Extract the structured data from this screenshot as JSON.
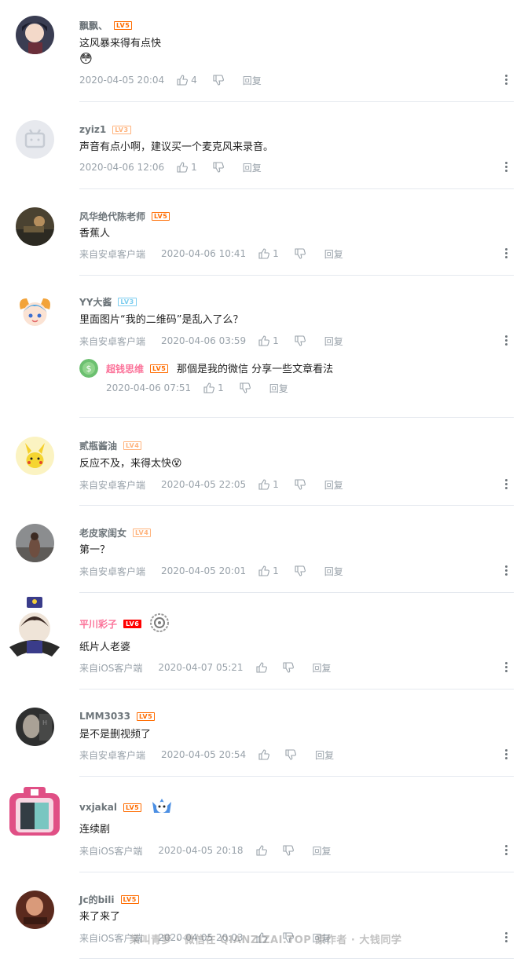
{
  "comments": [
    {
      "user": "飘飘、",
      "level": "LV5",
      "text": "这风暴来得有点快",
      "emoji": "😳",
      "time": "2020-04-05 20:04",
      "likes": "4",
      "reply": "回复"
    },
    {
      "user": "zyiz1",
      "level": "LV3",
      "text": "声音有点小啊，建议买一个麦克风来录音。",
      "time": "2020-04-06 12:06",
      "likes": "1",
      "reply": "回复"
    },
    {
      "user": "风华绝代陈老师",
      "level": "LV5",
      "text": "香蕉人",
      "source": "来自安卓客户端",
      "time": "2020-04-06 10:41",
      "likes": "1",
      "reply": "回复"
    },
    {
      "user": "YY大酱",
      "level": "LV3",
      "text": "里面图片“我的二维码”是乱入了么？",
      "source": "来自安卓客户端",
      "time": "2020-04-06 03:59",
      "likes": "1",
      "reply": "回复",
      "sub_reply": {
        "user": "超钱思维",
        "level": "LV5",
        "text": "那個是我的微信 分享一些文章看法",
        "time": "2020-04-06 07:51",
        "likes": "1",
        "reply": "回复"
      }
    },
    {
      "user": "贰瓶酱油",
      "level": "LV4",
      "text": "反应不及，来得太快",
      "emoji": "😵",
      "source": "来自安卓客户端",
      "time": "2020-04-05 22:05",
      "likes": "1",
      "reply": "回复"
    },
    {
      "user": "老皮家闺女",
      "level": "LV4",
      "text": "第一？",
      "source": "来自安卓客户端",
      "time": "2020-04-05 20:01",
      "likes": "1",
      "reply": "回复"
    },
    {
      "user": "平川彩子",
      "level": "LV6",
      "text": "纸片人老婆",
      "source": "来自iOS客户端",
      "time": "2020-04-07 05:21",
      "likes": "",
      "reply": "回复"
    },
    {
      "user": "LMM3033",
      "level": "LV5",
      "text": "是不是删视频了",
      "source": "来自安卓客户端",
      "time": "2020-04-05 20:54",
      "likes": "",
      "reply": "回复"
    },
    {
      "user": "vxjakal",
      "level": "LV5",
      "text": "连续剧",
      "source": "来自iOS客户端",
      "time": "2020-04-05 20:18",
      "likes": "",
      "reply": "回复"
    },
    {
      "user": "Jc的bili",
      "level": "LV5",
      "text": "来了来了",
      "source": "来自iOS客户端",
      "time": "2020-04-05 20:03",
      "likes": "",
      "reply": "回复"
    }
  ],
  "watermark": "某叫青萝 · 微信在 QIANZIZAI.TOP 原作者 · 大钱同学",
  "colors": {
    "accent_pink": "#fb7299",
    "meta_gray": "#99a2aa",
    "name_gray": "#6d757a",
    "divider": "#e5e9ef"
  }
}
